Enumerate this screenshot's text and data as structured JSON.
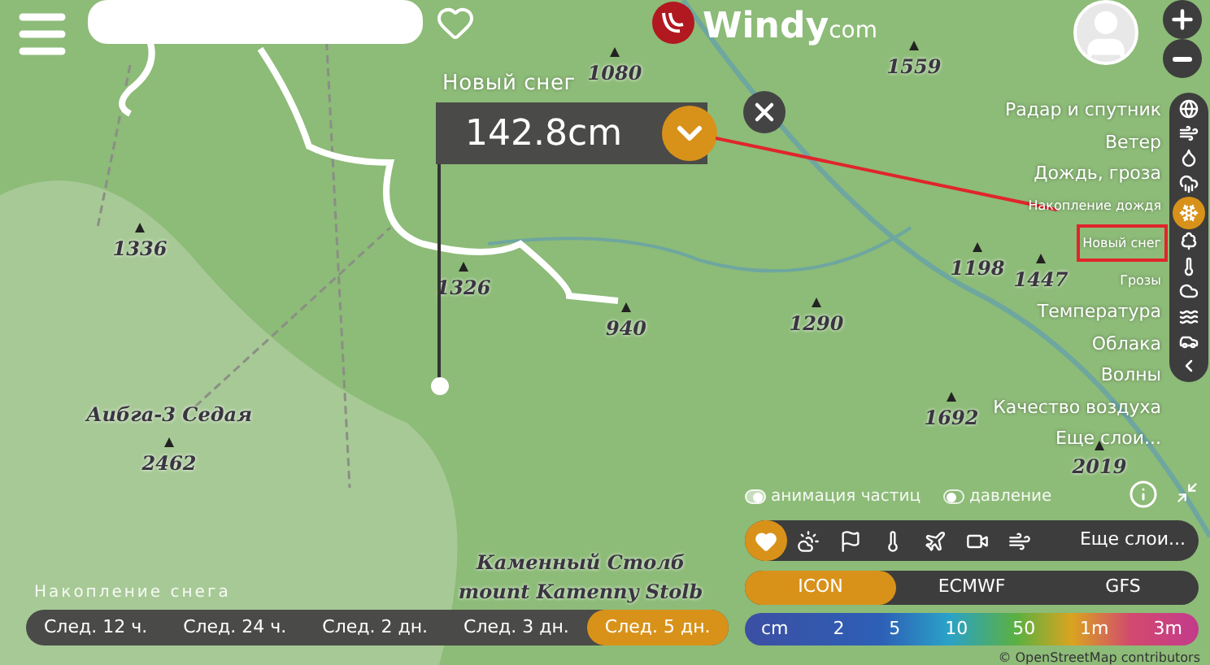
{
  "map": {
    "labels": [
      {
        "text": "1080",
        "kind": "peak"
      },
      {
        "text": "1559",
        "kind": "peak"
      },
      {
        "text": "1336",
        "kind": "peak"
      },
      {
        "text": "1326",
        "kind": "peak"
      },
      {
        "text": "940",
        "kind": "peak"
      },
      {
        "text": "1290",
        "kind": "peak"
      },
      {
        "text": "1198",
        "kind": "peak"
      },
      {
        "text": "1447",
        "kind": "peak"
      },
      {
        "text": "1692",
        "kind": "peak"
      },
      {
        "text": "2019",
        "kind": "peak"
      },
      {
        "text": "Аибга-3 Седая",
        "kind": "name"
      },
      {
        "text": "2462",
        "kind": "peak"
      },
      {
        "text": "Каменный Столб",
        "kind": "name"
      },
      {
        "text": "mount Kamenny Stolb",
        "kind": "name"
      }
    ],
    "attribution": "© OpenStreetMap contributors"
  },
  "top": {
    "logo": {
      "name": "Windy",
      "suffix": "com"
    }
  },
  "popup": {
    "layer": "Новый снег",
    "value": "142.8cm",
    "expanded": true
  },
  "layers": [
    {
      "label": "Радар и спутник",
      "kind": "major",
      "selected": false
    },
    {
      "label": "Ветер",
      "kind": "major",
      "selected": false
    },
    {
      "label": "Дождь, гроза",
      "kind": "major",
      "selected": false
    },
    {
      "label": "Накопление дождя",
      "kind": "minor",
      "selected": false
    },
    {
      "label": "Новый снег",
      "kind": "minor",
      "selected": true
    },
    {
      "label": "Грозы",
      "kind": "minor",
      "selected": false
    },
    {
      "label": "Температура",
      "kind": "major",
      "selected": false
    },
    {
      "label": "Облака",
      "kind": "major",
      "selected": false
    },
    {
      "label": "Волны",
      "kind": "major",
      "selected": false
    },
    {
      "label": "Качество воздуха",
      "kind": "major",
      "selected": false
    },
    {
      "label": "Еще слои...",
      "kind": "major",
      "selected": false
    }
  ],
  "layer_icons": [
    {
      "selected": false
    },
    {
      "selected": false
    },
    {
      "selected": false
    },
    {
      "selected": false
    },
    {
      "selected": true
    },
    {
      "selected": false
    },
    {
      "selected": false
    },
    {
      "selected": false
    },
    {
      "selected": false
    },
    {
      "selected": false
    },
    {
      "selected": false
    }
  ],
  "toggles": [
    {
      "label": "анимация частиц",
      "on": true
    },
    {
      "label": "давление",
      "on": false
    }
  ],
  "quick_layers": {
    "icons": [
      {
        "selected": true
      },
      {
        "selected": false
      },
      {
        "selected": false
      },
      {
        "selected": false
      },
      {
        "selected": false
      },
      {
        "selected": false
      },
      {
        "selected": false
      }
    ],
    "more": "Еще слои..."
  },
  "models": [
    {
      "label": "ICON",
      "selected": true
    },
    {
      "label": "ECMWF",
      "selected": false
    },
    {
      "label": "GFS",
      "selected": false
    }
  ],
  "legend": [
    "cm",
    "2",
    "5",
    "10",
    "50",
    "1m",
    "3m"
  ],
  "accumulation": {
    "title": "Накопление снега",
    "periods": [
      {
        "label": "След. 12 ч.",
        "selected": false
      },
      {
        "label": "След. 24 ч.",
        "selected": false
      },
      {
        "label": "След. 2 дн.",
        "selected": false
      },
      {
        "label": "След. 3 дн.",
        "selected": false
      },
      {
        "label": "След. 5 дн.",
        "selected": true
      }
    ]
  }
}
